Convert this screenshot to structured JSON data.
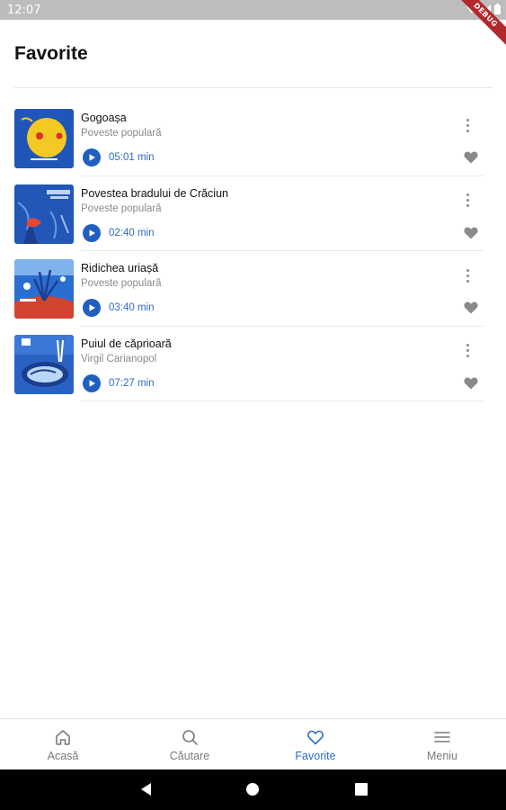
{
  "status_bar": {
    "time": "12:07",
    "icons": [
      "wifi-icon",
      "signal-icon",
      "battery-icon"
    ]
  },
  "debug_banner": "DEBUG",
  "header": {
    "title": "Favorite"
  },
  "stories": [
    {
      "title": "Gogoașa",
      "author": "Poveste populară",
      "duration": "05:01 min",
      "cover_icon": "gogoasa-cover-image"
    },
    {
      "title": "Povestea bradului de Crăciun",
      "author": "Poveste populară",
      "duration": "02:40 min",
      "cover_icon": "bradului-cover-image"
    },
    {
      "title": "Ridichea uriașă",
      "author": "Poveste populară",
      "duration": "03:40 min",
      "cover_icon": "ridichea-cover-image"
    },
    {
      "title": "Puiul de căprioară",
      "author": "Virgil Carianopol",
      "duration": "07:27 min",
      "cover_icon": "puiul-cover-image"
    }
  ],
  "bottom_nav": {
    "items": [
      {
        "label": "Acasă",
        "icon": "home-icon",
        "active": false
      },
      {
        "label": "Căutare",
        "icon": "search-icon",
        "active": false
      },
      {
        "label": "Favorite",
        "icon": "heart-icon",
        "active": true
      },
      {
        "label": "Meniu",
        "icon": "menu-icon",
        "active": false
      }
    ]
  },
  "colors": {
    "accent": "#2c6acb",
    "play_button": "#1f5fbf",
    "muted": "#8a8a8a",
    "debug_ribbon": "#b3282d"
  }
}
